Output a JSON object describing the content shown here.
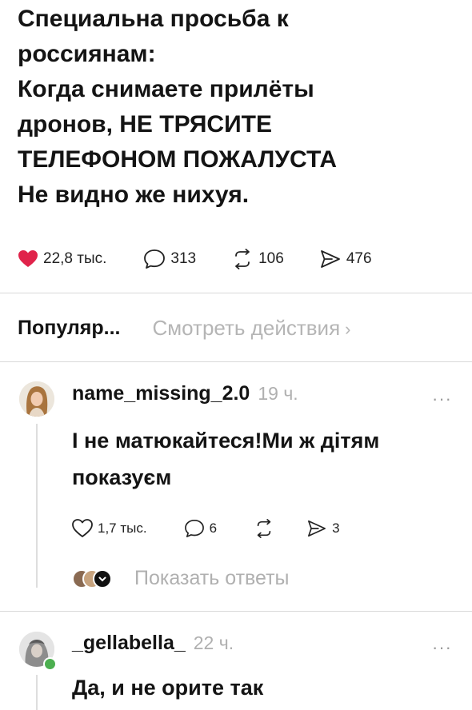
{
  "post": {
    "lines": [
      "Специальна просьба к",
      "россиянам:",
      "Когда снимаете прилёты",
      "дронов, НЕ ТРЯСИТЕ",
      "ТЕЛЕФОНОМ ПОЖАЛУСТА",
      "Не видно же нихуя."
    ],
    "likes": "22,8 тыс.",
    "comments": "313",
    "reposts": "106",
    "shares": "476"
  },
  "sort": {
    "label": "Популяр...",
    "view_actions": "Смотреть действия",
    "chevron": "›"
  },
  "comments": [
    {
      "username": "name_missing_2.0",
      "time": "19 ч.",
      "more": "···",
      "text_lines": [
        "І не матюкайтеся!Ми ж дітям",
        "показуєм"
      ],
      "likes": "1,7 тыс.",
      "replies": "6",
      "shares": "3",
      "show_replies": "Показать ответы"
    },
    {
      "username": "_gellabella_",
      "time": "22 ч.",
      "more": "···",
      "text_lines": [
        "Да, и не орите так"
      ]
    }
  ],
  "colors": {
    "heart": "#e0234a",
    "online": "#4caf50",
    "muted": "#b0b0b0"
  },
  "icons": [
    "heart-icon",
    "comment-icon",
    "repost-icon",
    "share-icon",
    "more-icon",
    "chevron-right-icon"
  ]
}
